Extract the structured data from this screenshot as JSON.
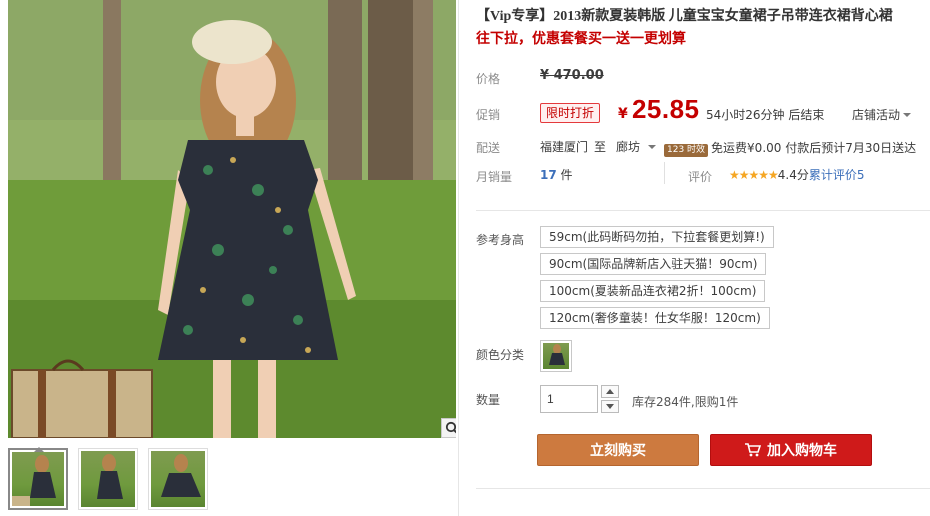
{
  "product": {
    "title": "【Vip专享】2013新款夏装韩版 儿童宝宝女童裙子吊带连衣裙背心裙",
    "promo_line": "往下拉，优惠套餐买一送一更划算"
  },
  "price": {
    "label": "价格",
    "original": "¥ 470.00"
  },
  "sale": {
    "label": "促销",
    "tag": "限时打折",
    "currency": "¥",
    "amount": "25.85",
    "countdown": "54小时26分钟 后结束",
    "store_activity": "店铺活动"
  },
  "shipping": {
    "label": "配送",
    "from": "福建厦门",
    "to_word": "至",
    "to": "廊坊",
    "timely_badge": "123 时效",
    "detail": "免运费¥0.00 付款后预计7月30日送达"
  },
  "sales": {
    "label": "月销量",
    "count": "17",
    "unit": "件",
    "rating_label": "评价",
    "stars": "★★★★★",
    "score": "4.4分",
    "rating_link": "累计评价5"
  },
  "sizes": {
    "label": "参考身高",
    "options": [
      "59cm(此码断码勿拍，下拉套餐更划算!)",
      "90cm(国际品牌新店入驻天猫！90cm)",
      "100cm(夏装新品连衣裙2折！100cm)",
      "120cm(奢侈童装！仕女华服！120cm)"
    ]
  },
  "color": {
    "label": "颜色分类"
  },
  "quantity": {
    "label": "数量",
    "value": "1",
    "stock_text": "库存284件,限购1件"
  },
  "actions": {
    "buy_now": "立刻购买",
    "add_to_cart": "加入购物车"
  },
  "icons": {
    "zoom": "magnifier-icon",
    "cart": "shopping-cart-icon"
  },
  "colors": {
    "price_red": "#c40000",
    "buy_button": "#cd7a3f",
    "cart_button": "#cf1a1a",
    "link_blue": "#3c6fba",
    "star": "#f5a623"
  }
}
